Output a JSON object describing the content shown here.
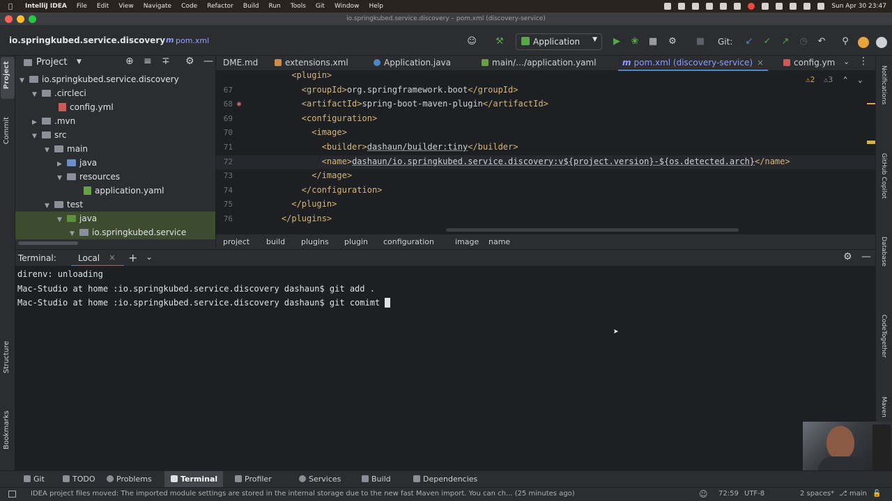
{
  "menubar": {
    "app": "IntelliJ IDEA",
    "items": [
      "File",
      "Edit",
      "View",
      "Navigate",
      "Code",
      "Refactor",
      "Build",
      "Run",
      "Tools",
      "Git",
      "Window",
      "Help"
    ],
    "clock": "Sun Apr 30  23:47"
  },
  "window": {
    "title": "io.springkubed.service.discovery – pom.xml (discovery-service)"
  },
  "navbar": {
    "project": "io.springkubed.service.discovery",
    "file": "pom.xml",
    "run_config": "Application",
    "git_label": "Git:"
  },
  "project_panel": {
    "title": "Project",
    "items": [
      {
        "label": "io.springkubed.service.discovery",
        "kind": "module"
      },
      {
        "label": ".circleci",
        "kind": "folder"
      },
      {
        "label": "config.yml",
        "kind": "yml"
      },
      {
        "label": ".mvn",
        "kind": "folder"
      },
      {
        "label": "src",
        "kind": "folder"
      },
      {
        "label": "main",
        "kind": "folder"
      },
      {
        "label": "java",
        "kind": "source"
      },
      {
        "label": "resources",
        "kind": "resources"
      },
      {
        "label": "application.yaml",
        "kind": "yaml"
      },
      {
        "label": "test",
        "kind": "folder"
      },
      {
        "label": "java",
        "kind": "test-source"
      },
      {
        "label": "io.springkubed.service",
        "kind": "package"
      }
    ]
  },
  "tabs": [
    {
      "label": "DME.md"
    },
    {
      "label": "extensions.xml"
    },
    {
      "label": "Application.java"
    },
    {
      "label": "main/…/application.yaml"
    },
    {
      "label": "pom.xml (discovery-service)"
    },
    {
      "label": "config.ym"
    }
  ],
  "editor": {
    "inspections_warnings": "2",
    "inspections_weak": "3",
    "lines": [
      {
        "num": "",
        "indent": "      ",
        "open": "<plugin>",
        "text": "",
        "close": ""
      },
      {
        "num": "67",
        "indent": "        ",
        "open": "<groupId>",
        "text": "org.springframework.boot",
        "close": "</groupId>"
      },
      {
        "num": "68",
        "indent": "        ",
        "open": "<artifactId>",
        "text": "spring-boot-maven-plugin",
        "close": "</artifactId>"
      },
      {
        "num": "69",
        "indent": "        ",
        "open": "<configuration>",
        "text": "",
        "close": ""
      },
      {
        "num": "70",
        "indent": "          ",
        "open": "<image>",
        "text": "",
        "close": ""
      },
      {
        "num": "71",
        "indent": "            ",
        "open": "<builder>",
        "text": "dashaun/builder:tiny",
        "close": "</builder>"
      },
      {
        "num": "72",
        "indent": "            ",
        "open": "<name>",
        "text": "dashaun/io.springkubed.service.discovery:v${project.version}-${os.detected.arch}",
        "close": "</name>"
      },
      {
        "num": "73",
        "indent": "          ",
        "open": "</image>",
        "text": "",
        "close": ""
      },
      {
        "num": "74",
        "indent": "        ",
        "open": "</configuration>",
        "text": "",
        "close": ""
      },
      {
        "num": "75",
        "indent": "      ",
        "open": "</plugin>",
        "text": "",
        "close": ""
      },
      {
        "num": "76",
        "indent": "    ",
        "open": "</plugins>",
        "text": "",
        "close": ""
      }
    ]
  },
  "breadcrumb": [
    "project",
    "build",
    "plugins",
    "plugin",
    "configuration",
    "image",
    "name"
  ],
  "terminal": {
    "title": "Terminal:",
    "tab": "Local",
    "lines": [
      "direnv: unloading",
      "Mac-Studio at home :io.springkubed.service.discovery dashaun$ git add .",
      "Mac-Studio at home :io.springkubed.service.discovery dashaun$ git comimt "
    ]
  },
  "left_strip": [
    "Project",
    "Commit",
    "Structure",
    "Bookmarks"
  ],
  "right_strip": [
    "Notifications",
    "GitHub Copilot",
    "Database",
    "CodeTogether",
    "Maven"
  ],
  "bottom_tabs": [
    {
      "label": "Git"
    },
    {
      "label": "TODO"
    },
    {
      "label": "Problems"
    },
    {
      "label": "Terminal"
    },
    {
      "label": "Profiler"
    },
    {
      "label": "Services"
    },
    {
      "label": "Build"
    },
    {
      "label": "Dependencies"
    }
  ],
  "status": {
    "message": "IDEA project files moved: The imported module settings are stored in the internal storage due to the new fast Maven import. You can ch... (25 minutes ago)",
    "position": "72:59",
    "encoding": "UTF-8",
    "indent": "2 spaces*",
    "branch": "main"
  },
  "colors": {
    "accent": "#4a88c7",
    "xml_tag": "#d5b778",
    "selected_tree": "#3d4b2e",
    "run_green": "#57a64a"
  }
}
